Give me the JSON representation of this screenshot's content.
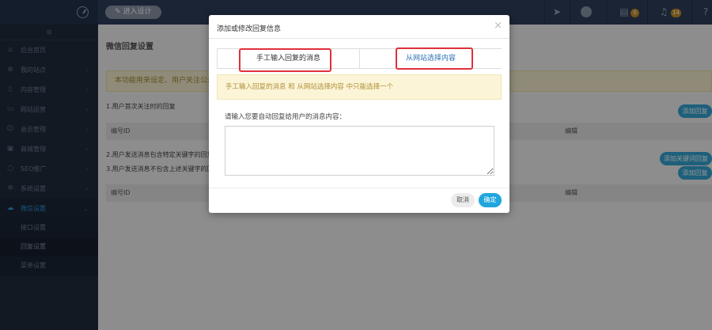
{
  "topbar": {
    "enter_design_label": "进入设计",
    "badges": [
      "0",
      "14"
    ]
  },
  "sidebar": {
    "items": [
      {
        "label": "后台首页",
        "icon": "home-icon"
      },
      {
        "label": "我的站点",
        "icon": "globe-icon"
      },
      {
        "label": "内容管理",
        "icon": "document-icon"
      },
      {
        "label": "网站运营",
        "icon": "monitor-icon"
      },
      {
        "label": "会员管理",
        "icon": "users-icon"
      },
      {
        "label": "商城管理",
        "icon": "store-icon"
      },
      {
        "label": "SEO推广",
        "icon": "search-icon"
      },
      {
        "label": "系统设置",
        "icon": "gear-icon"
      },
      {
        "label": "微信设置",
        "icon": "wechat-icon"
      }
    ],
    "subitems": [
      "接口设置",
      "回复设置",
      "菜单设置"
    ]
  },
  "main": {
    "title": "微信回复设置",
    "notice": "本功能用来设定、用户关注公众",
    "section1_label": "1.用户首次关注时的回复",
    "col_id": "编号ID",
    "col_edit": "编辑",
    "section2_label": "2.用户发送消息包含特定关键字的回复",
    "section3_label": "3.用户发送消息不包含上述关键字的回复",
    "add_reply_button": "添加回复",
    "add_keyword_reply_button": "添加关键词回复",
    "add_reply_button_2": "添加回复"
  },
  "modal": {
    "title": "添加或修改回复信息",
    "close_glyph": "×",
    "tab_manual": "手工输入回复的消息",
    "tab_from_site": "从网站选择内容",
    "hint": "手工输入回复的消息 和 从网站选择内容 中只能选择一个",
    "message_label": "请输入您要自动回复给用户的消息内容：",
    "message_value": "",
    "cancel_label": "取消",
    "confirm_label": "确定"
  },
  "colors": {
    "accent": "#1fa6dd",
    "highlight_outline": "#e0303b",
    "sidebar_bg": "#1f2b3c",
    "topbar_bg": "#2d3f5c"
  }
}
